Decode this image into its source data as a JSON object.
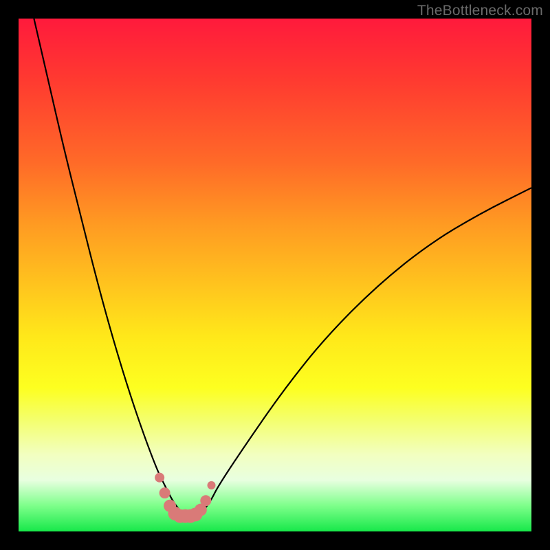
{
  "watermark": "TheBottleneck.com",
  "colors": {
    "frame": "#000000",
    "curve": "#000000",
    "markers": "#d97a78",
    "gradient_top": "#ff1a3c",
    "gradient_bottom": "#17e84a"
  },
  "chart_data": {
    "type": "line",
    "title": "",
    "xlabel": "",
    "ylabel": "",
    "xlim": [
      0,
      100
    ],
    "ylim": [
      0,
      100
    ],
    "series": [
      {
        "name": "bottleneck-curve",
        "x": [
          3,
          6,
          9,
          12,
          15,
          18,
          21,
          24,
          27,
          28.5,
          30,
          31.5,
          33,
          34.5,
          36,
          37.5,
          39,
          45,
          52,
          60,
          70,
          80,
          90,
          100
        ],
        "y": [
          100,
          87,
          74,
          62,
          50,
          39,
          29,
          20,
          12,
          9,
          6,
          4,
          3,
          3,
          4,
          6,
          9,
          18,
          28,
          38,
          48,
          56,
          62,
          67
        ]
      }
    ],
    "markers": {
      "name": "highlight-cluster",
      "x": [
        27.5,
        28.5,
        29.5,
        30.5,
        31.5,
        32.5,
        33.5,
        34.5,
        35.5,
        36.5,
        37.6
      ],
      "y": [
        10.5,
        7.5,
        5,
        3.5,
        3,
        3,
        3,
        3.3,
        4.2,
        6,
        9
      ],
      "r": [
        7,
        8,
        9,
        10,
        10,
        10,
        10,
        10,
        9,
        8,
        6
      ]
    },
    "grid": false,
    "legend": false
  }
}
